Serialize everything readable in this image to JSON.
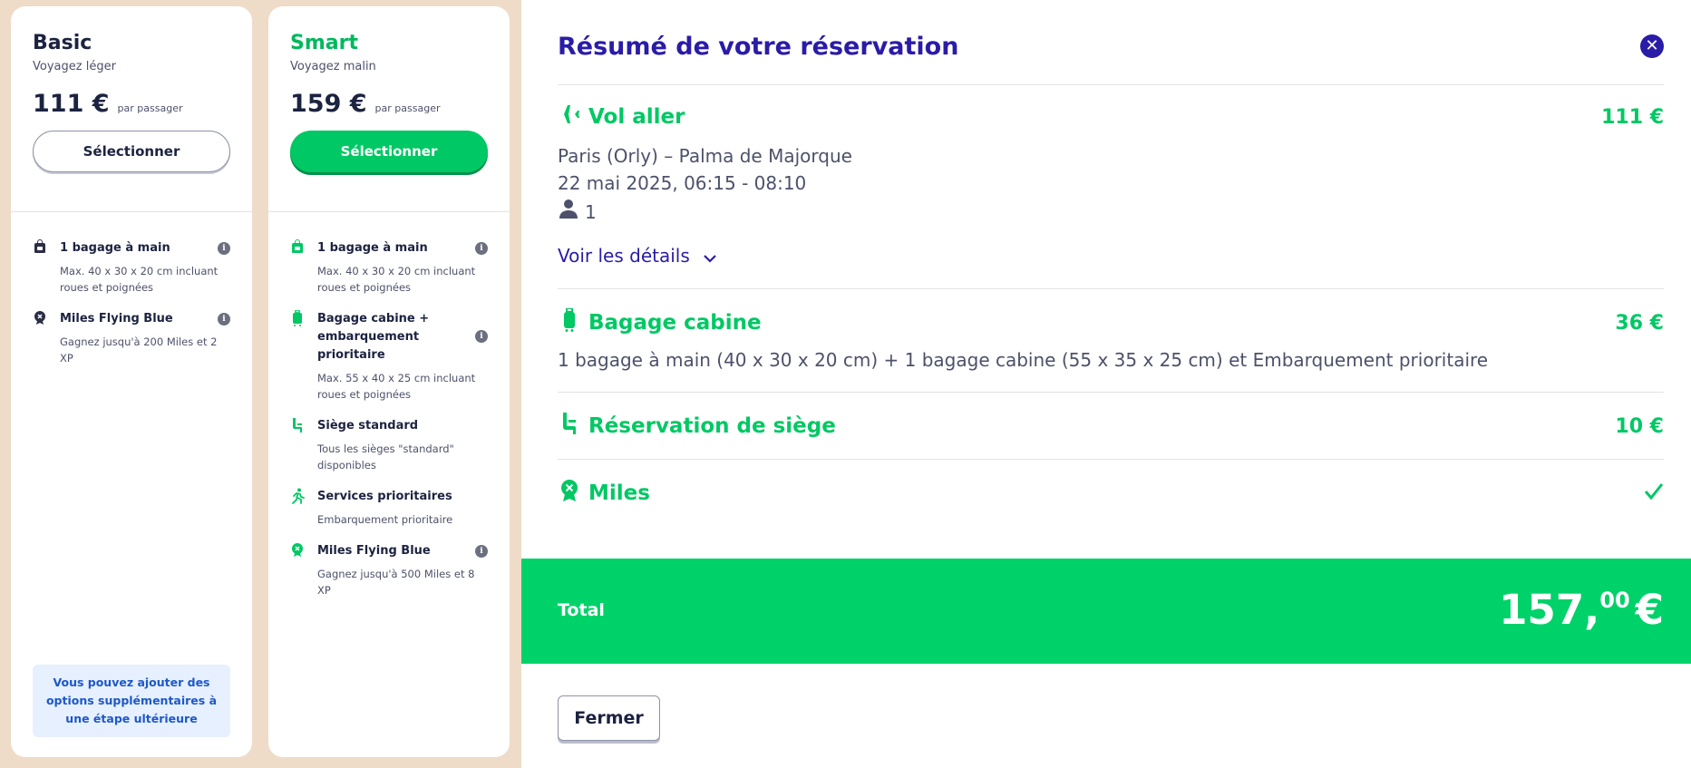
{
  "fares": {
    "basic": {
      "name": "Basic",
      "subtitle": "Voyagez léger",
      "price": "111 €",
      "per_passenger": "par passager",
      "select_label": "Sélectionner",
      "features": [
        {
          "icon": "backpack-icon",
          "title": "1 bagage à main",
          "desc": "Max. 40 x 30 x 20 cm incluant roues et poignées"
        },
        {
          "icon": "miles-badge-icon",
          "title": "Miles Flying Blue",
          "desc": "Gagnez jusqu'à 200 Miles et 2 XP"
        }
      ],
      "notice": "Vous pouvez ajouter des options supplémentaires à une étape ultérieure"
    },
    "smart": {
      "name": "Smart",
      "subtitle": "Voyagez malin",
      "price": "159 €",
      "per_passenger": "par passager",
      "select_label": "Sélectionner",
      "features": [
        {
          "icon": "backpack-icon",
          "title": "1 bagage à main",
          "desc": "Max. 40 x 30 x 20 cm incluant roues et poignées"
        },
        {
          "icon": "suitcase-icon",
          "title": "Bagage cabine + embarquement prioritaire",
          "desc": "Max. 55 x 40 x 25 cm incluant roues et poignées"
        },
        {
          "icon": "seat-icon",
          "title": "Siège standard",
          "desc": "Tous les sièges \"standard\" disponibles"
        },
        {
          "icon": "running-person-icon",
          "title": "Services prioritaires",
          "desc": "Embarquement prioritaire"
        },
        {
          "icon": "miles-badge-icon",
          "title": "Miles Flying Blue",
          "desc": "Gagnez jusqu'à 500 Miles et 8 XP"
        }
      ]
    }
  },
  "summary": {
    "title": "Résumé de votre réservation",
    "flight": {
      "title": "Vol aller",
      "price": "111 €",
      "route": "Paris (Orly) – Palma de Majorque",
      "datetime": "22 mai 2025, 06:15 - 08:10",
      "passengers": "1",
      "details_link": "Voir les détails"
    },
    "baggage": {
      "title": "Bagage cabine",
      "price": "36 €",
      "desc": "1 bagage à main (40 x 30 x 20 cm) + 1 bagage cabine (55 x 35 x 25 cm) et Embarquement prioritaire"
    },
    "seat": {
      "title": "Réservation de siège",
      "price": "10 €"
    },
    "miles": {
      "title": "Miles"
    },
    "total": {
      "label": "Total",
      "amount_main": "157,",
      "amount_cents": "00",
      "currency": "€"
    },
    "close_label": "Fermer"
  },
  "colors": {
    "accent_green": "#00c864",
    "title_indigo": "#2a1ca6",
    "background": "#eedcc9"
  }
}
